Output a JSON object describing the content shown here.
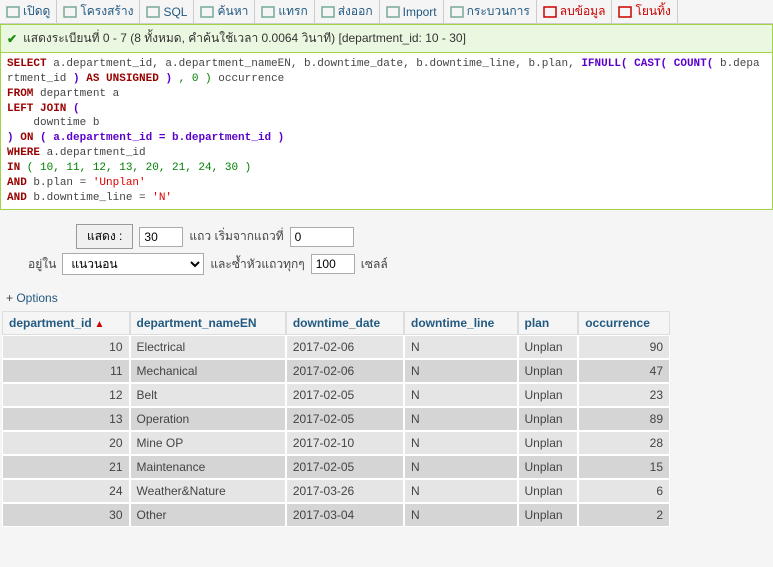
{
  "tabs": [
    {
      "label": "เปิดดู"
    },
    {
      "label": "โครงสร้าง"
    },
    {
      "label": "SQL"
    },
    {
      "label": "ค้นหา"
    },
    {
      "label": "แทรก"
    },
    {
      "label": "ส่งออก"
    },
    {
      "label": "Import"
    },
    {
      "label": "กระบวนการ"
    },
    {
      "label": "ลบข้อมูล",
      "red": true
    },
    {
      "label": "โยนทิ้ง",
      "red": true
    }
  ],
  "success_msg": "แสดงระเบียนที่ 0 - 7 (8 ทั้งหมด, คำค้นใช้เวลา 0.0064 วินาที) [department_id: 10 - 30]",
  "sql": {
    "cols": "a.department_id, a.department_nameEN, b.downtime_date, b.downtime_line, b.plan,",
    "ifnull_a": "IFNULL(",
    "cast_a": " CAST(",
    "count_a": " COUNT(",
    "count_arg": " b.department_id ",
    "count_b": ")",
    "as_kw": " AS ",
    "unsigned_kw": "UNSIGNED",
    "cast_b": " )",
    "zero": " , 0 )",
    "occurrence_alias": " occurrence",
    "from": " department a",
    "leftjoin": " (",
    "joininner": "    downtime b",
    "on": " ( a.department_id = b.department_id )",
    "where": " a.department_id",
    "in_list": " ( 10, 11, 12, 13, 20, 21, 24, 30 )",
    "and1": " b.plan = ",
    "unplan": "'Unplan'",
    "and2": " b.downtime_line = ",
    "n": "'N'"
  },
  "controls": {
    "show": "แสดง :",
    "show_btn": "แสดง :",
    "limit": "30",
    "start_at_lbl": "แถว เริ่มจากแถวที่",
    "start_at_val": "0",
    "in_lbl": "อยู่ใน",
    "orientation": "แนวนอน",
    "repeat_lbl": "และซ้ำหัวแถวทุกๆ",
    "repeat_val": "100",
    "cells": "เซลล์"
  },
  "options_link": "  Options",
  "table": {
    "headers": [
      "department_id",
      "department_nameEN",
      "downtime_date",
      "downtime_line",
      "plan",
      "occurrence"
    ],
    "sort_col": 0,
    "rows": [
      {
        "id": 10,
        "name": "Electrical",
        "date": "2017-02-06",
        "line": "N",
        "plan": "Unplan",
        "occ": 90
      },
      {
        "id": 11,
        "name": "Mechanical",
        "date": "2017-02-06",
        "line": "N",
        "plan": "Unplan",
        "occ": 47
      },
      {
        "id": 12,
        "name": "Belt",
        "date": "2017-02-05",
        "line": "N",
        "plan": "Unplan",
        "occ": 23
      },
      {
        "id": 13,
        "name": "Operation",
        "date": "2017-02-05",
        "line": "N",
        "plan": "Unplan",
        "occ": 89
      },
      {
        "id": 20,
        "name": "Mine OP",
        "date": "2017-02-10",
        "line": "N",
        "plan": "Unplan",
        "occ": 28
      },
      {
        "id": 21,
        "name": "Maintenance",
        "date": "2017-02-05",
        "line": "N",
        "plan": "Unplan",
        "occ": 15
      },
      {
        "id": 24,
        "name": "Weather&Nature",
        "date": "2017-03-26",
        "line": "N",
        "plan": "Unplan",
        "occ": 6
      },
      {
        "id": 30,
        "name": "Other",
        "date": "2017-03-04",
        "line": "N",
        "plan": "Unplan",
        "occ": 2
      }
    ]
  }
}
